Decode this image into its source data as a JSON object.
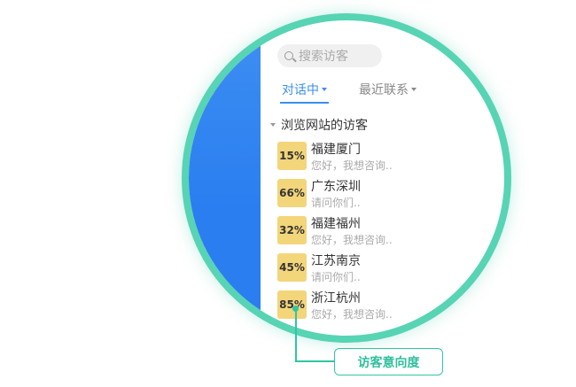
{
  "search": {
    "placeholder": "搜索访客"
  },
  "tabs": [
    {
      "label": "对话中",
      "active": true
    },
    {
      "label": "最近联系",
      "active": false
    }
  ],
  "section": {
    "title": "浏览网站的访客"
  },
  "visitors": [
    {
      "percent": "15%",
      "location": "福建厦门",
      "message": "您好，我想咨询.."
    },
    {
      "percent": "66%",
      "location": "广东深圳",
      "message": "请问你们.."
    },
    {
      "percent": "32%",
      "location": "福建福州",
      "message": "您好，我想咨询.."
    },
    {
      "percent": "45%",
      "location": "江苏南京",
      "message": "请问你们.."
    },
    {
      "percent": "85%",
      "location": "浙江杭州",
      "message": "您好，我想咨询.."
    }
  ],
  "callout": {
    "label": "访客意向度"
  },
  "colors": {
    "ring": "#57d4b3",
    "panel_blue": "#2a7ef0",
    "accent_blue": "#3b8ef0",
    "badge": "#f3d57a",
    "callout": "#2fc6a3"
  }
}
